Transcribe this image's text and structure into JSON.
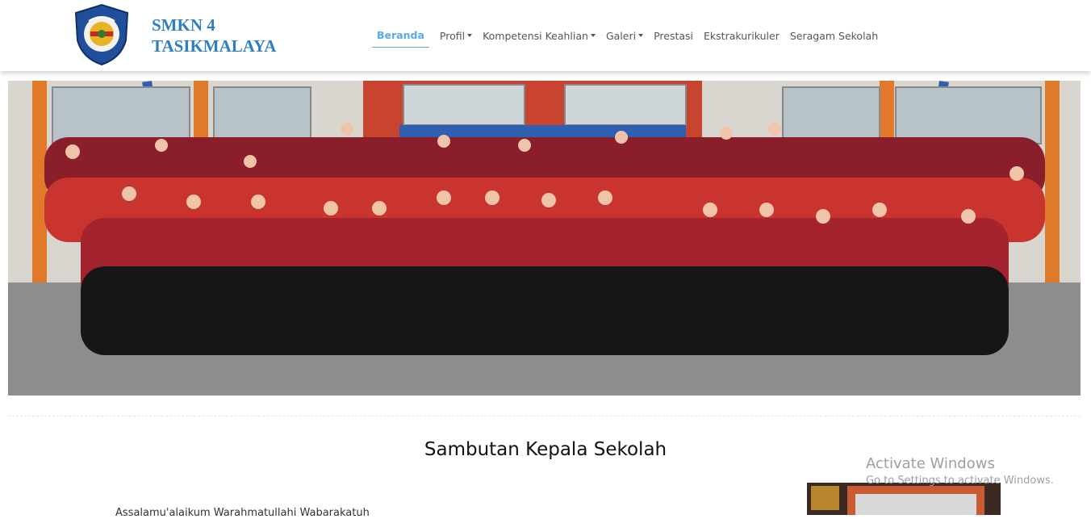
{
  "brand": {
    "line1": "SMKN 4",
    "line2": "TASIKMALAYA",
    "logo_icon": "school-emblem-logo",
    "color": "#2f7fbf"
  },
  "nav": {
    "items": [
      {
        "label": "Beranda",
        "active": true,
        "dropdown": false
      },
      {
        "label": "Profil",
        "active": false,
        "dropdown": true
      },
      {
        "label": "Kompetensi Keahlian",
        "active": false,
        "dropdown": true
      },
      {
        "label": "Galeri",
        "active": false,
        "dropdown": true
      },
      {
        "label": "Prestasi",
        "active": false,
        "dropdown": false
      },
      {
        "label": "Ekstrakurikuler",
        "active": false,
        "dropdown": false
      },
      {
        "label": "Seragam Sekolah",
        "active": false,
        "dropdown": false
      }
    ],
    "active_color": "#5aa9e6"
  },
  "hero": {
    "image": "staff-group-photo"
  },
  "section": {
    "title": "Sambutan Kepala Sekolah",
    "intro": "Assalamu'alaikum Warahmatullahi Wabarakatuh"
  },
  "watermark": {
    "line1": "Activate Windows",
    "line2": "Go to Settings to activate Windows."
  }
}
